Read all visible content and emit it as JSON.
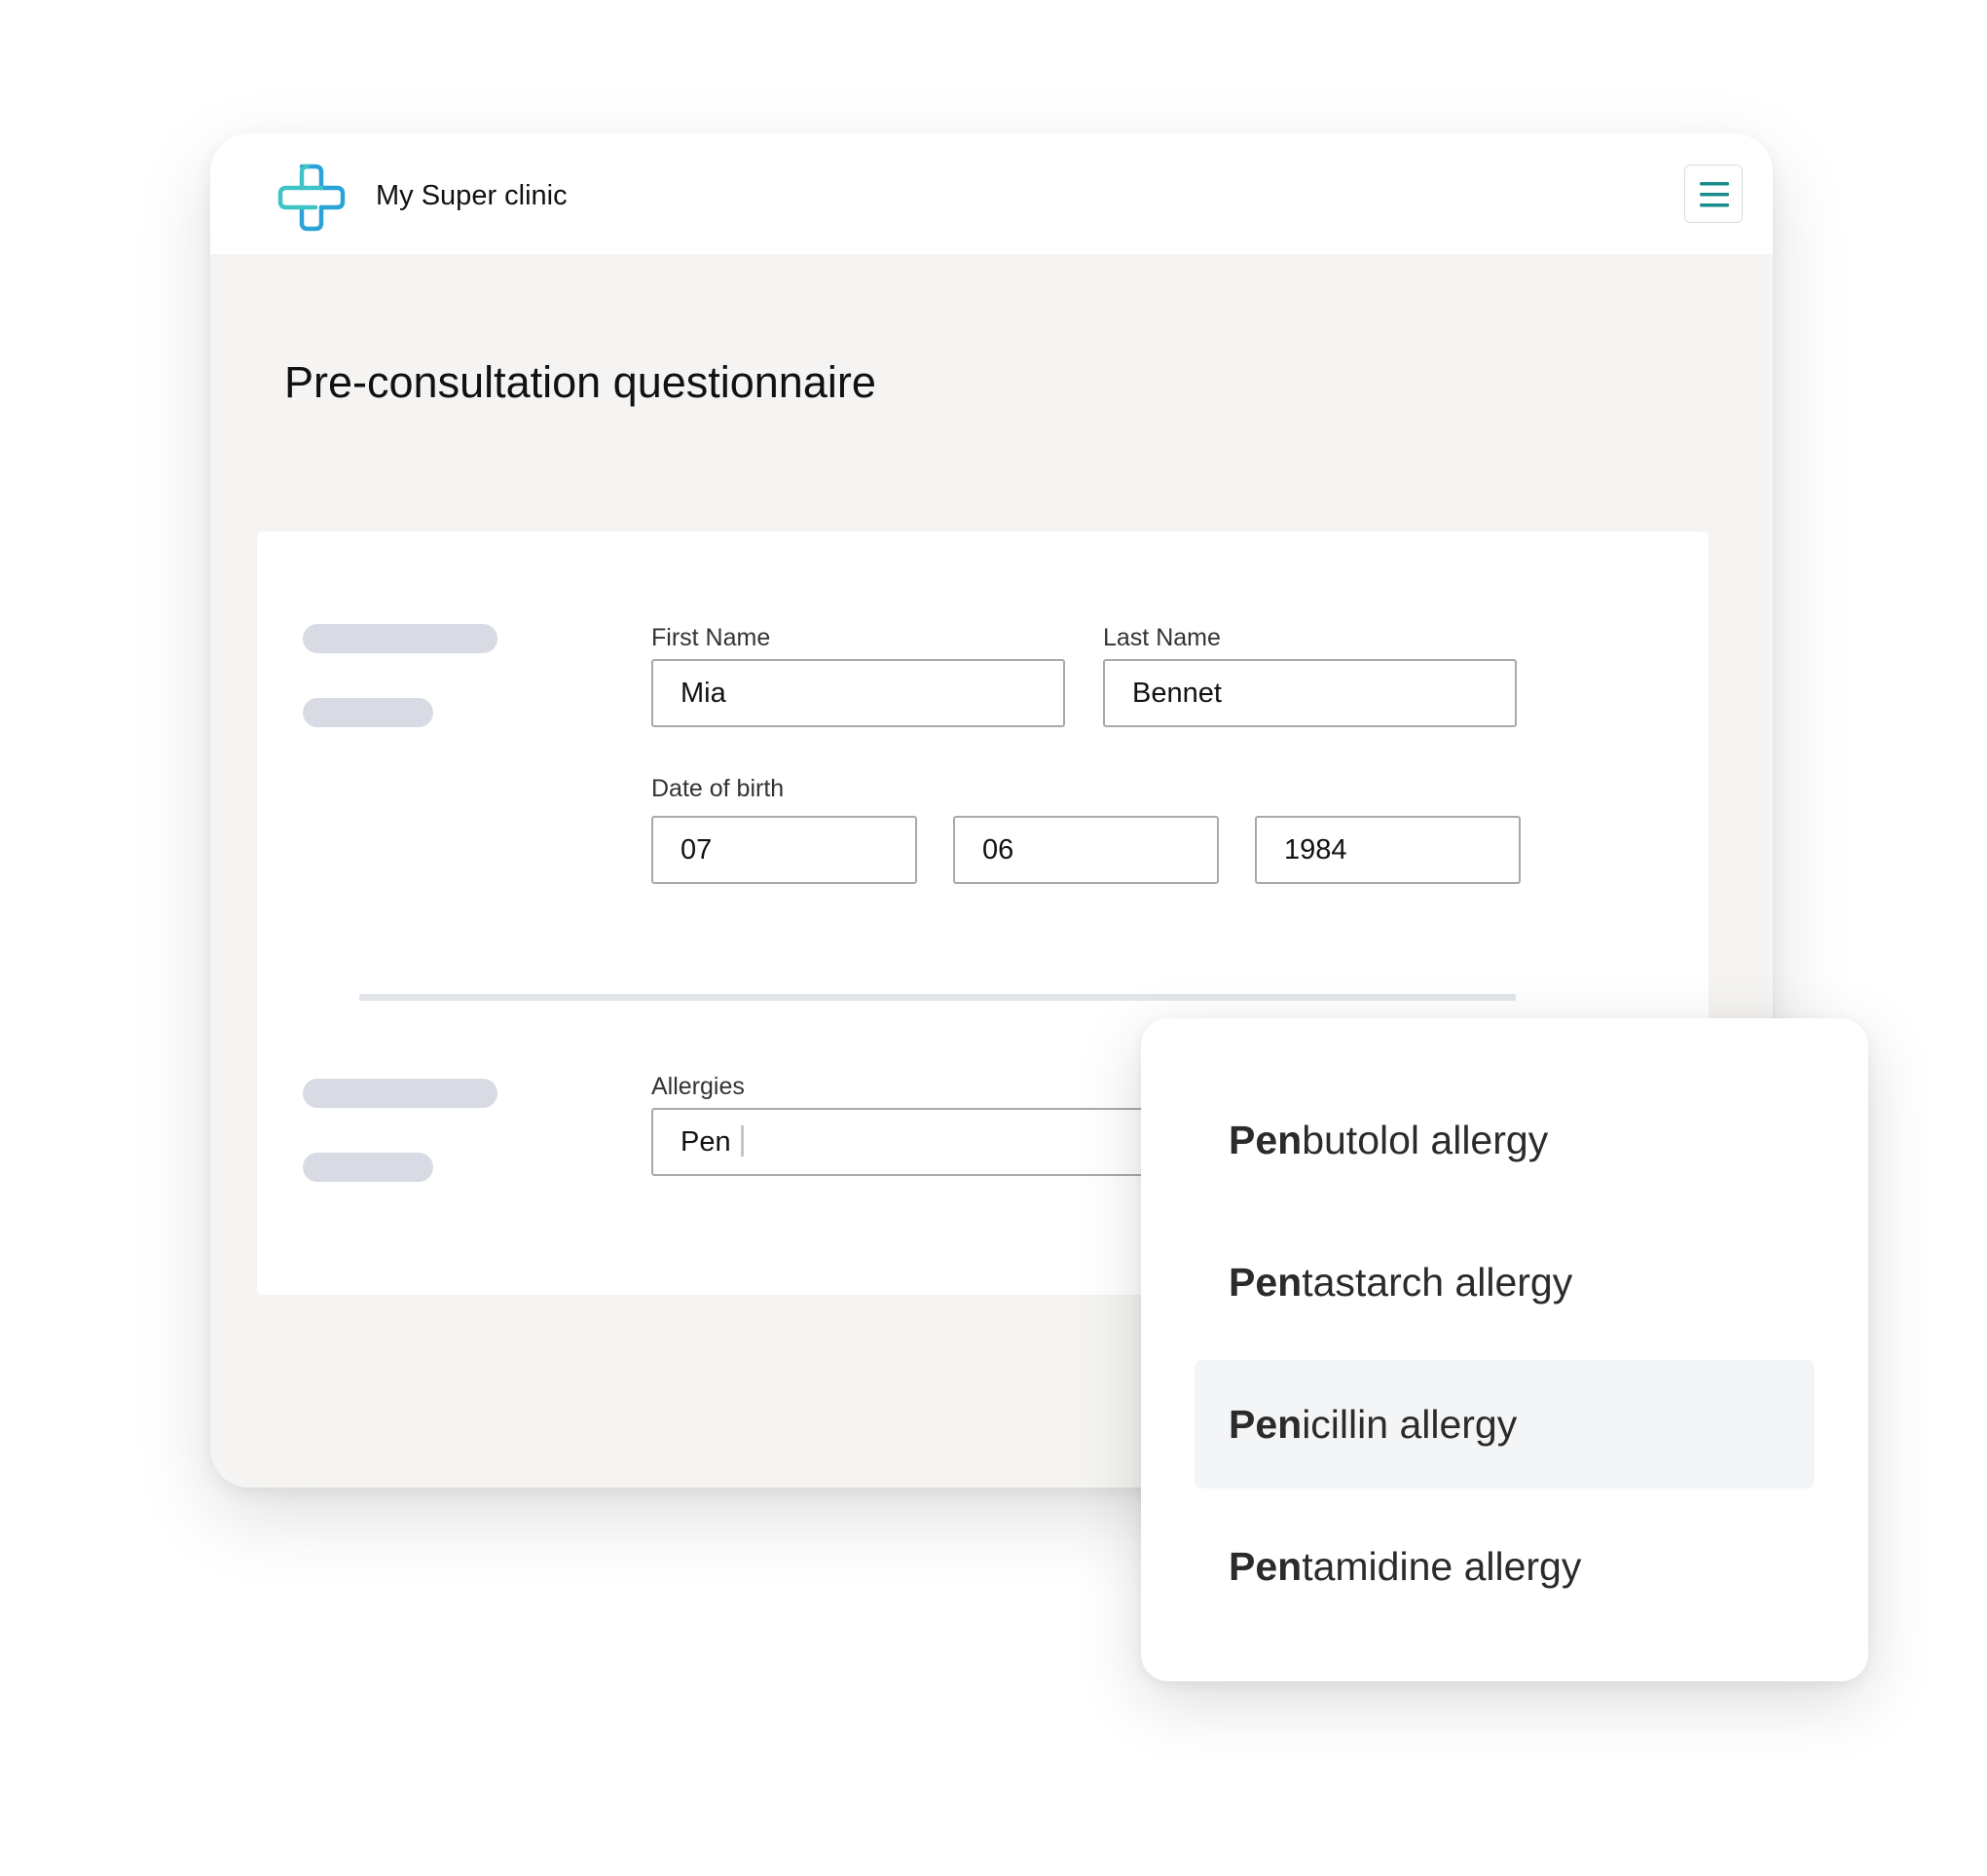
{
  "app": {
    "brand_name": "My Super clinic",
    "logo_icon": "medical-cross-icon",
    "menu_icon": "hamburger-menu-icon",
    "accent_color": "#1a8c8c",
    "logo_colors": [
      "#3ec3c6",
      "#2aa3d6"
    ]
  },
  "page": {
    "title": "Pre-consultation questionnaire"
  },
  "form": {
    "first_name": {
      "label": "First Name",
      "value": "Mia"
    },
    "last_name": {
      "label": "Last Name",
      "value": "Bennet"
    },
    "dob": {
      "label": "Date of birth",
      "day": "07",
      "month": "06",
      "year": "1984"
    },
    "allergies": {
      "label": "Allergies",
      "value": "Pen"
    }
  },
  "dropdown": {
    "highlighted_index": 2,
    "options": [
      {
        "match": "Pen",
        "rest": "butolol allergy"
      },
      {
        "match": "Pen",
        "rest": "tastarch allergy"
      },
      {
        "match": "Pen",
        "rest": "icillin allergy"
      },
      {
        "match": "Pen",
        "rest": "tamidine allergy"
      }
    ]
  }
}
